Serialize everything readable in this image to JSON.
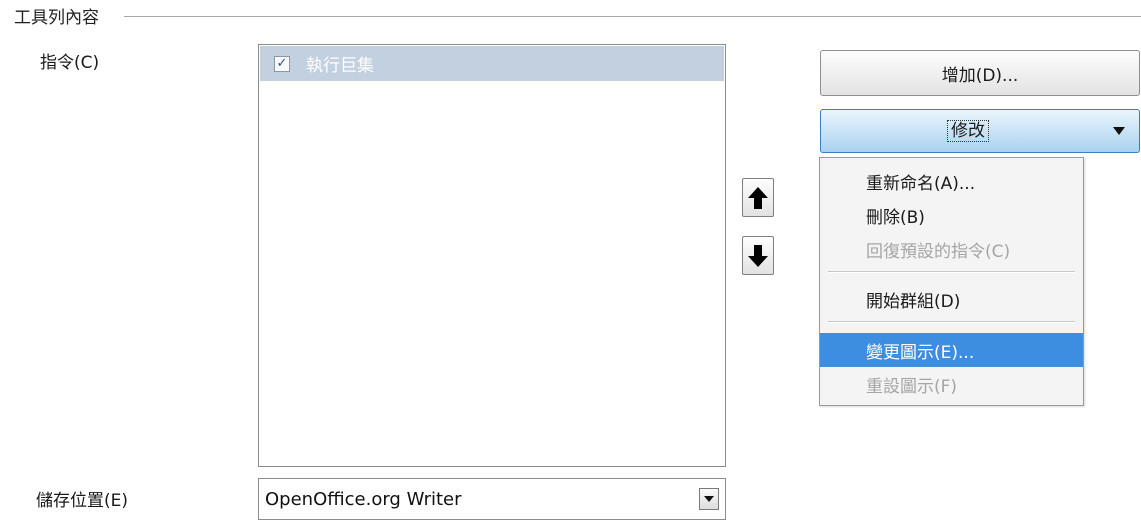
{
  "group": {
    "title": "工具列內容"
  },
  "commands": {
    "label": "指令(C)",
    "items": [
      {
        "label": "執行巨集",
        "checked": true
      }
    ]
  },
  "save_in": {
    "label": "儲存位置(E)",
    "value": "OpenOffice.org Writer"
  },
  "buttons": {
    "add": "增加(D)...",
    "modify": "修改"
  },
  "modify_menu": {
    "items": [
      {
        "label": "重新命名(A)...",
        "state": "enabled"
      },
      {
        "label": "刪除(B)",
        "state": "enabled"
      },
      {
        "label": "回復預設的指令(C)",
        "state": "disabled"
      },
      {
        "label": "開始群組(D)",
        "state": "enabled"
      },
      {
        "label": "變更圖示(E)...",
        "state": "highlighted"
      },
      {
        "label": "重設圖示(F)",
        "state": "disabled"
      }
    ]
  },
  "colors": {
    "list_selection": "#c3d0e0",
    "menu_highlight": "#3d8ee0",
    "modify_button": "#a9d2f0"
  },
  "icons": {
    "move_up": "arrow-up-icon",
    "move_down": "arrow-down-icon",
    "modify_caret": "caret-down-icon",
    "save_dropdown": "caret-down-icon",
    "checkbox": "checkmark-icon"
  }
}
